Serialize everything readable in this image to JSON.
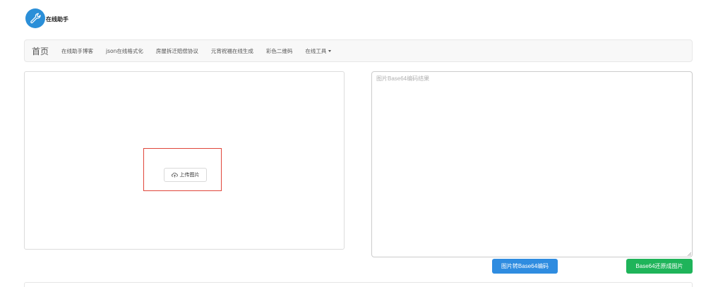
{
  "logo": {
    "text": "在线助手",
    "icon": "wrench-icon",
    "color": "#2b8fd8"
  },
  "nav": {
    "brand": "首页",
    "items": [
      "在线助手博客",
      "json在线格式化",
      "房屋拆迁赔偿协议",
      "元宵祝福在线生成",
      "彩色二维码"
    ],
    "dropdown": "在线工具"
  },
  "upload": {
    "label": "上传图片",
    "icon": "cloud-upload-icon",
    "border_color": "#e0463a"
  },
  "result": {
    "placeholder": "图片Base64编码结果",
    "value": ""
  },
  "buttons": {
    "encode": {
      "label": "图片转Base64编码",
      "color": "#2f8ce0"
    },
    "decode": {
      "label": "Base64还原成图片",
      "color": "#1fb45a"
    }
  }
}
